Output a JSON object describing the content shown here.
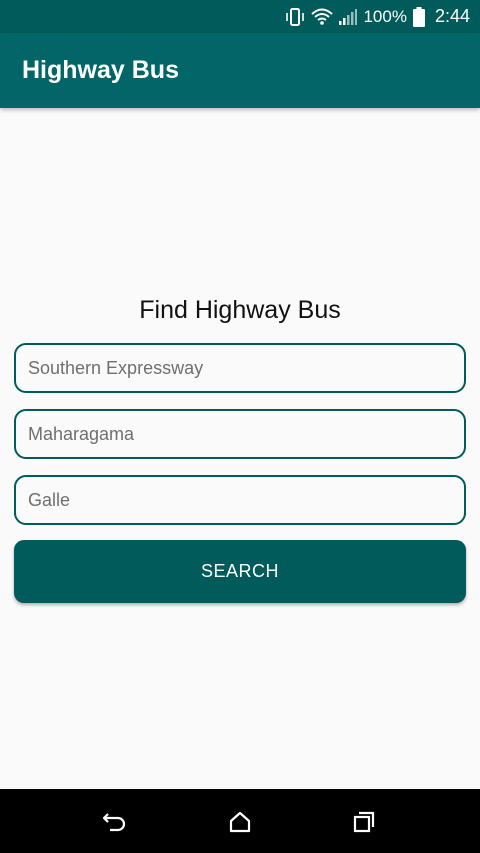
{
  "status_bar": {
    "battery": "100%",
    "time": "2:44",
    "icons": [
      "vibrate-icon",
      "wifi-icon",
      "signal-icon",
      "battery-icon"
    ]
  },
  "app_bar": {
    "title": "Highway Bus",
    "color": "#026668"
  },
  "search_form": {
    "heading": "Find Highway Bus",
    "route_placeholder": "Southern Expressway",
    "from_placeholder": "Maharagama",
    "to_placeholder": "Galle",
    "search_label": "SEARCH",
    "accent_color": "#005b5a"
  },
  "nav_bar": {
    "icons": [
      "back-icon",
      "home-icon",
      "recents-icon"
    ]
  }
}
